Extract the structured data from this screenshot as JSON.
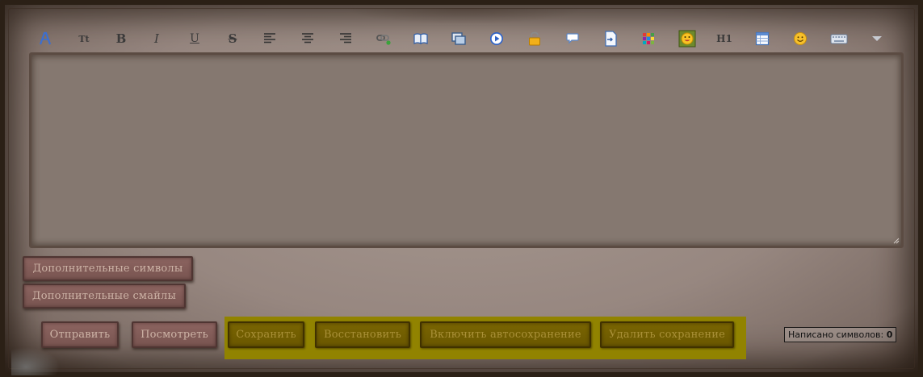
{
  "toolbar": {
    "items": [
      {
        "name": "font-color-icon"
      },
      {
        "name": "font-size-icon",
        "text": "Tt"
      },
      {
        "name": "bold-icon",
        "text": "B"
      },
      {
        "name": "italic-icon",
        "text": "I"
      },
      {
        "name": "underline-icon",
        "text": "U"
      },
      {
        "name": "strikethrough-icon",
        "text": "S"
      },
      {
        "name": "align-left-icon"
      },
      {
        "name": "align-center-icon"
      },
      {
        "name": "align-right-icon"
      },
      {
        "name": "link-icon"
      },
      {
        "name": "book-icon"
      },
      {
        "name": "image-icon"
      },
      {
        "name": "video-icon"
      },
      {
        "name": "lock-icon"
      },
      {
        "name": "speech-bubble-icon"
      },
      {
        "name": "document-icon"
      },
      {
        "name": "color-grid-icon"
      },
      {
        "name": "smiley-box-icon"
      },
      {
        "name": "heading-icon",
        "text": "H1"
      },
      {
        "name": "table-icon"
      },
      {
        "name": "smiley-icon"
      },
      {
        "name": "keyboard-icon"
      },
      {
        "name": "more-dropdown-icon"
      }
    ]
  },
  "editor": {
    "value": ""
  },
  "extras": {
    "symbols_label": "Дополнительные символы",
    "smileys_label": "Дополнительные смайлы"
  },
  "actions": {
    "send_label": "Отправить",
    "preview_label": "Посмотреть",
    "save_label": "Сохранить",
    "restore_label": "Восстановить",
    "autosave_label": "Включить автосохранение",
    "delete_save_label": "Удалить сохранение"
  },
  "counter": {
    "label": "Написано символов:",
    "value": "0"
  },
  "colors": {
    "highlight": "#918300",
    "frame_bg": "#978780",
    "editor_bg": "#857870",
    "button_red": "#7e5854",
    "button_gold": "#6f5c00"
  }
}
